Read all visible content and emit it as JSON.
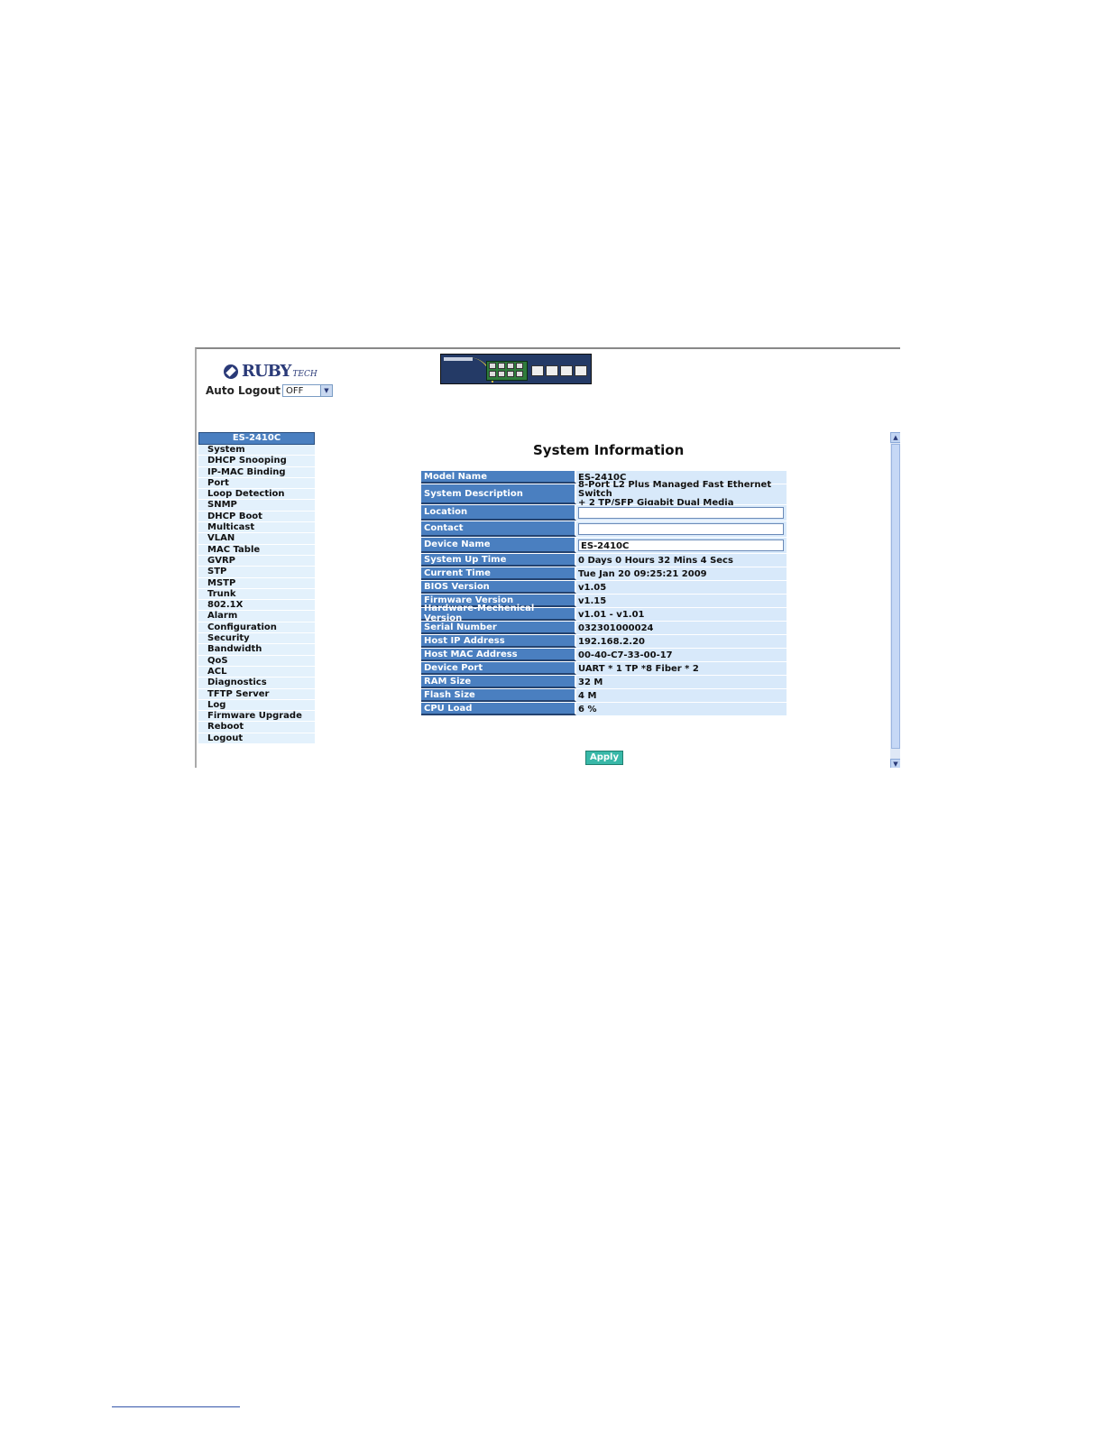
{
  "header": {
    "brand": "RUBY",
    "brand_suffix": "TECH",
    "auto_logout_label": "Auto Logout",
    "auto_logout_value": "OFF"
  },
  "sidebar": {
    "title": "ES-2410C",
    "items": [
      "System",
      "DHCP Snooping",
      "IP-MAC Binding",
      "Port",
      "Loop Detection",
      "SNMP",
      "DHCP Boot",
      "Multicast",
      "VLAN",
      "MAC Table",
      "GVRP",
      "STP",
      "MSTP",
      "Trunk",
      "802.1X",
      "Alarm",
      "Configuration",
      "Security",
      "Bandwidth",
      "QoS",
      "ACL",
      "Diagnostics",
      "TFTP Server",
      "Log",
      "Firmware Upgrade",
      "Reboot",
      "Logout"
    ]
  },
  "main": {
    "title": "System Information",
    "apply_label": "Apply",
    "rows": [
      {
        "label": "Model Name",
        "value": "ES-2410C"
      },
      {
        "label": "System Description",
        "value": "8-Port L2 Plus Managed Fast Ethernet Switch",
        "value2": "+ 2 TP/SFP Gigabit Dual Media"
      },
      {
        "label": "Location",
        "input": ""
      },
      {
        "label": "Contact",
        "input": ""
      },
      {
        "label": "Device Name",
        "input": "ES-2410C"
      },
      {
        "label": "System Up Time",
        "value": "0 Days 0 Hours 32 Mins 4 Secs"
      },
      {
        "label": "Current Time",
        "value": "Tue Jan 20 09:25:21 2009"
      },
      {
        "label": "BIOS Version",
        "value": "v1.05"
      },
      {
        "label": "Firmware Version",
        "value": "v1.15"
      },
      {
        "label": "Hardware-Mechenical Version",
        "value": "v1.01 - v1.01"
      },
      {
        "label": "Serial Number",
        "value": "032301000024"
      },
      {
        "label": "Host IP Address",
        "value": "192.168.2.20"
      },
      {
        "label": "Host MAC Address",
        "value": "00-40-C7-33-00-17"
      },
      {
        "label": "Device Port",
        "value": "UART * 1 TP *8 Fiber * 2"
      },
      {
        "label": "RAM Size",
        "value": "32 M"
      },
      {
        "label": "Flash Size",
        "value": "4 M"
      },
      {
        "label": "CPU Load",
        "value": "6 %"
      }
    ]
  },
  "colors": {
    "menu_bg": "#e3f1fc",
    "header_blue": "#4a7fc0",
    "value_bg": "#d8e9fa",
    "apply_button": "#38b8a8"
  }
}
